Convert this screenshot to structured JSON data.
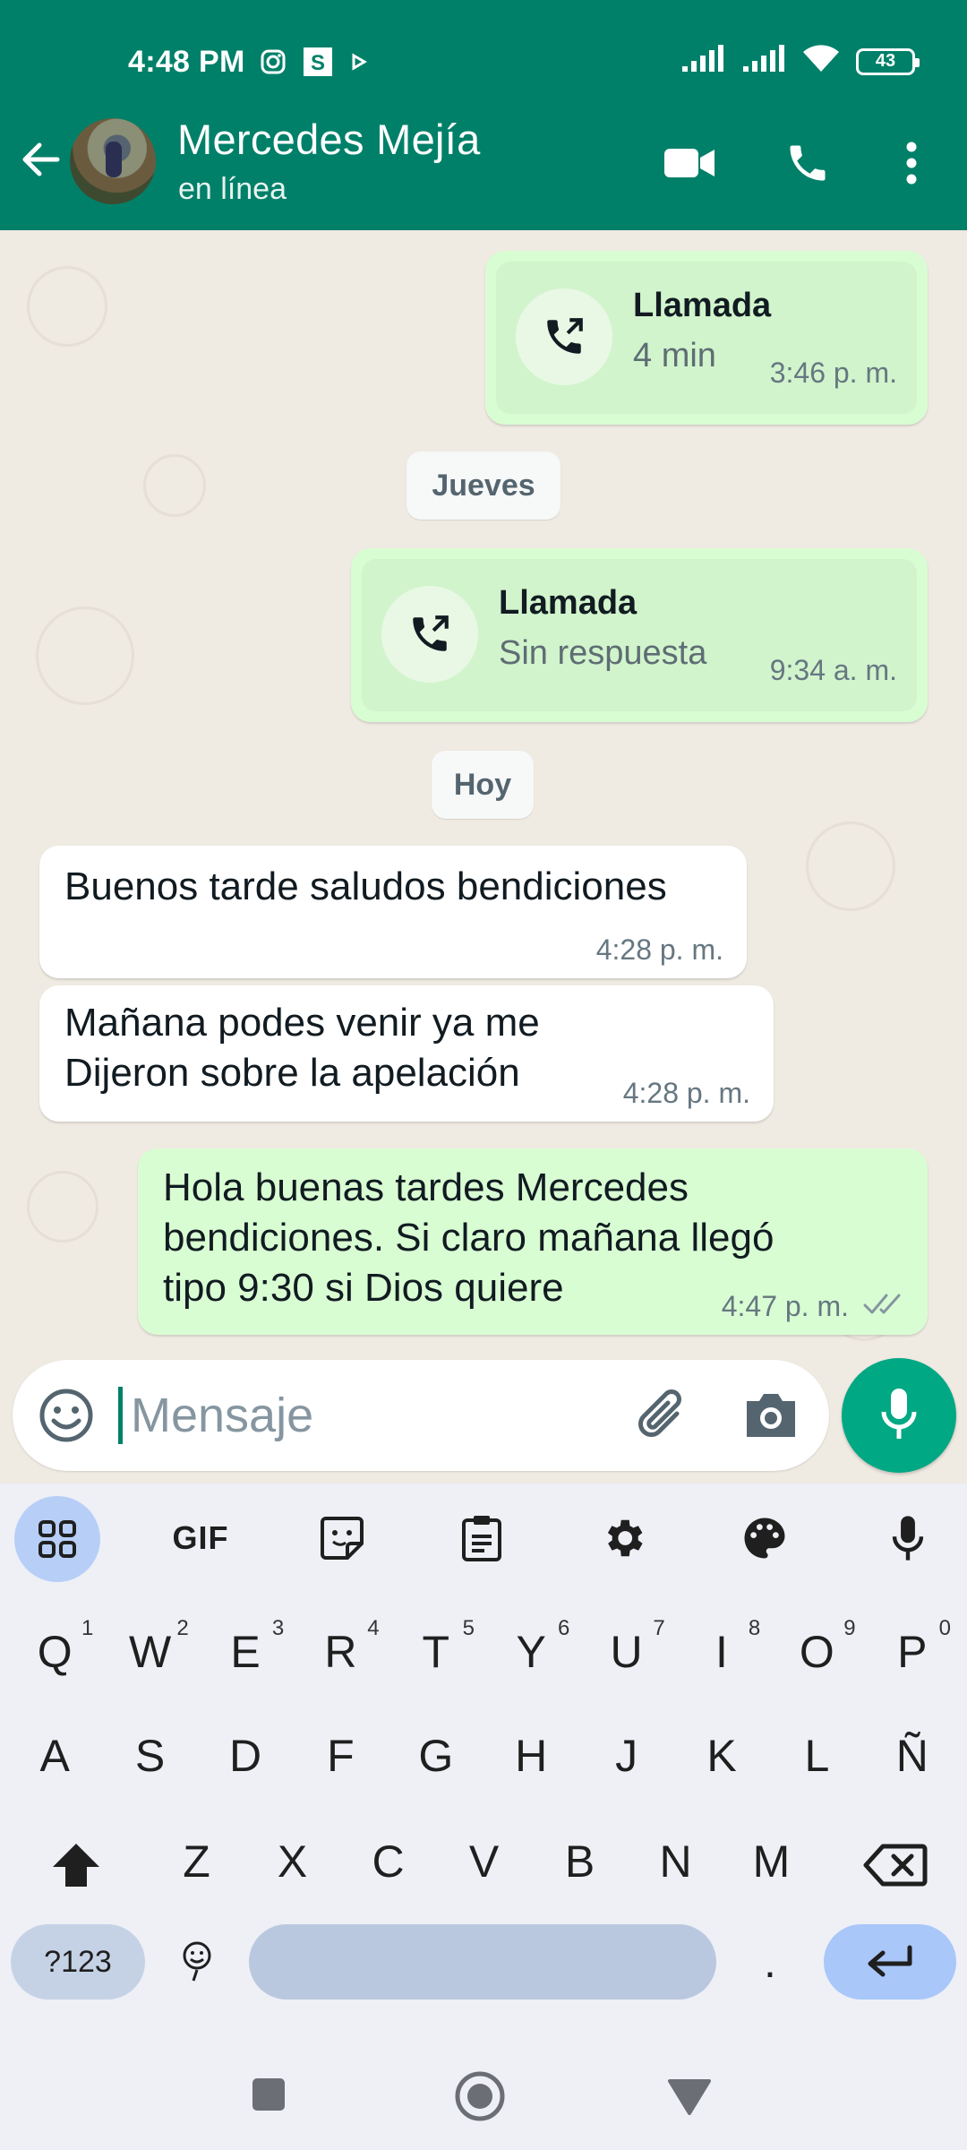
{
  "status_bar": {
    "time": "4:48 PM",
    "notification_icons": [
      "instagram-icon",
      "s-app-icon",
      "play-icon"
    ],
    "battery": "43",
    "right_icons": [
      "signal-icon",
      "signal-icon",
      "wifi-icon",
      "battery-icon"
    ]
  },
  "header": {
    "contact_name": "Mercedes Mejía",
    "contact_status": "en línea",
    "actions": [
      "video-call-icon",
      "phone-icon",
      "more-vert-icon"
    ],
    "color": "#008069"
  },
  "messages": [
    {
      "type": "call",
      "direction": "out",
      "title": "Llamada",
      "subtitle": "4 min",
      "time": "3:46 p. m."
    },
    {
      "type": "date",
      "label": "Jueves"
    },
    {
      "type": "call",
      "direction": "out",
      "title": "Llamada",
      "subtitle": "Sin respuesta",
      "time": "9:34 a. m."
    },
    {
      "type": "date",
      "label": "Hoy"
    },
    {
      "type": "text",
      "direction": "in",
      "lines": [
        "Buenos tarde saludos bendiciones"
      ],
      "time": "4:28 p. m."
    },
    {
      "type": "text",
      "direction": "in",
      "lines": [
        "Mañana podes venir ya me",
        "Dijeron sobre la apelación"
      ],
      "time": "4:28 p. m."
    },
    {
      "type": "text",
      "direction": "out",
      "lines": [
        "Hola buenas tardes Mercedes",
        "bendiciones. Si claro mañana llegó",
        "tipo 9:30 si Dios quiere"
      ],
      "time": "4:47 p. m.",
      "status": "read-double-check-icon"
    }
  ],
  "composer": {
    "placeholder": "Mensaje",
    "accent": "#00a884"
  },
  "keyboard": {
    "toolbar": [
      "apps-grid-icon",
      "GIF",
      "sticker-icon",
      "clipboard-icon",
      "settings-gear-icon",
      "palette-icon",
      "mic-icon"
    ],
    "row1": [
      {
        "k": "Q",
        "n": "1"
      },
      {
        "k": "W",
        "n": "2"
      },
      {
        "k": "E",
        "n": "3"
      },
      {
        "k": "R",
        "n": "4"
      },
      {
        "k": "T",
        "n": "5"
      },
      {
        "k": "Y",
        "n": "6"
      },
      {
        "k": "U",
        "n": "7"
      },
      {
        "k": "I",
        "n": "8"
      },
      {
        "k": "O",
        "n": "9"
      },
      {
        "k": "P",
        "n": "0"
      }
    ],
    "row2": [
      "A",
      "S",
      "D",
      "F",
      "G",
      "H",
      "J",
      "K",
      "L",
      "Ñ"
    ],
    "row3": [
      "Z",
      "X",
      "C",
      "V",
      "B",
      "N",
      "M"
    ],
    "symbols_label": "?123",
    "period": "."
  },
  "nav": [
    "recents-square-icon",
    "home-circle-icon",
    "back-triangle-icon"
  ]
}
